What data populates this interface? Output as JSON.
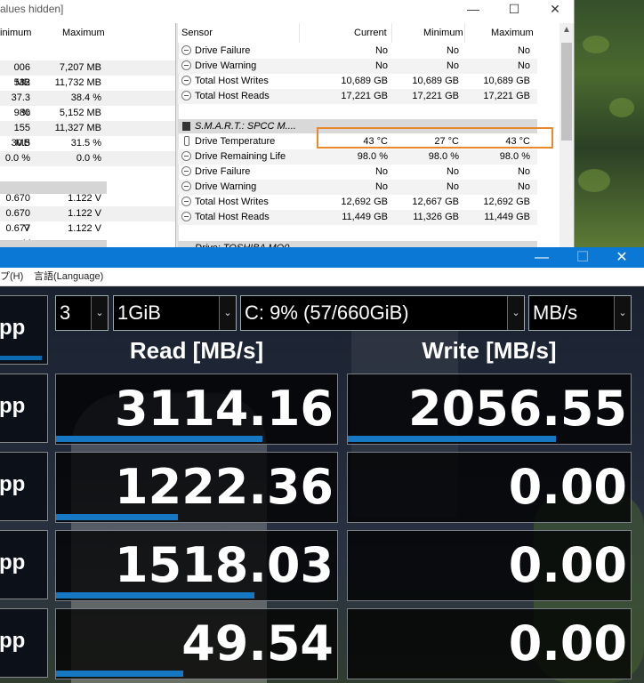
{
  "hwinfo": {
    "title_fragment": "alues hidden]",
    "controls": {
      "minimize": "—",
      "maximize": "☐",
      "close": "✕"
    },
    "left_panel": {
      "headers": {
        "minimum": "inimum",
        "maximum": "Maximum"
      },
      "rows": [
        {
          "min": "006 MB",
          "max": "7,207 MB"
        },
        {
          "min": "532 MB",
          "max": "11,732 MB"
        },
        {
          "min": "37.3 %",
          "max": "38.4 %"
        },
        {
          "min": "980 MB",
          "max": "5,152 MB"
        },
        {
          "min": "155 MB",
          "max": "11,327 MB"
        },
        {
          "min": "30.5 %",
          "max": "31.5 %"
        },
        {
          "min": "0.0 %",
          "max": "0.0 %"
        },
        {
          "min": "0.670 V",
          "max": "1.122 V"
        },
        {
          "min": "0.670 V",
          "max": "1.122 V"
        },
        {
          "min": "0.677 V",
          "max": "1.122 V"
        }
      ]
    },
    "right_panel": {
      "headers": {
        "sensor": "Sensor",
        "current": "Current",
        "minimum": "Minimum",
        "maximum": "Maximum"
      },
      "group1": [
        {
          "label": "Drive Failure",
          "cur": "No",
          "min": "No",
          "max": "No"
        },
        {
          "label": "Drive Warning",
          "cur": "No",
          "min": "No",
          "max": "No"
        },
        {
          "label": "Total Host Writes",
          "cur": "10,689 GB",
          "min": "10,689 GB",
          "max": "10,689 GB"
        },
        {
          "label": "Total Host Reads",
          "cur": "17,221 GB",
          "min": "17,221 GB",
          "max": "17,221 GB"
        }
      ],
      "section_title": "S.M.A.R.T.: SPCC M....",
      "group2": [
        {
          "label": "Drive Temperature",
          "cur": "43 °C",
          "min": "27 °C",
          "max": "43 °C"
        },
        {
          "label": "Drive Remaining Life",
          "cur": "98.0 %",
          "min": "98.0 %",
          "max": "98.0 %"
        },
        {
          "label": "Drive Failure",
          "cur": "No",
          "min": "No",
          "max": "No"
        },
        {
          "label": "Drive Warning",
          "cur": "No",
          "min": "No",
          "max": "No"
        },
        {
          "label": "Total Host Writes",
          "cur": "12,692 GB",
          "min": "12,667 GB",
          "max": "12,692 GB"
        },
        {
          "label": "Total Host Reads",
          "cur": "11,449 GB",
          "min": "11,326 GB",
          "max": "11,449 GB"
        }
      ],
      "next_section_fragment": "Drive: TOSHIBA MQ0"
    },
    "highlight_color": "#e8892d"
  },
  "cdm": {
    "controls": {
      "minimize": "—",
      "maximize": "☐",
      "close": "✕"
    },
    "menu": {
      "help_fragment": "プ(H)",
      "language": "言語(Language)"
    },
    "left_buttons": [
      "pp",
      "pp",
      "pp",
      "pp",
      "pp"
    ],
    "selects": {
      "count": "3",
      "size": "1GiB",
      "drive": "C: 9% (57/660GiB)",
      "unit": "MB/s"
    },
    "headers": {
      "read": "Read [MB/s]",
      "write": "Write [MB/s]"
    },
    "results": [
      {
        "read": "3114.16",
        "write": "2056.55",
        "read_fill": 0.73,
        "write_fill": 0.73
      },
      {
        "read": "1222.36",
        "write": "0.00",
        "read_fill": 0.43,
        "write_fill": 0.0
      },
      {
        "read": "1518.03",
        "write": "0.00",
        "read_fill": 0.7,
        "write_fill": 0.0
      },
      {
        "read": "49.54",
        "write": "0.00",
        "read_fill": 0.45,
        "write_fill": 0.0
      }
    ],
    "accent_color": "#1677c2",
    "titlebar_color": "#0a78d4"
  }
}
